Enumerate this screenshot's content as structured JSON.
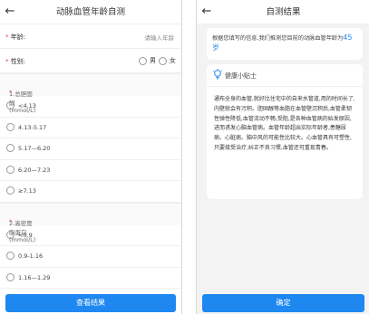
{
  "left": {
    "title": "动脉血管年龄自测",
    "age": {
      "label": "年龄:",
      "placeholder": "请输入年龄"
    },
    "gender": {
      "label": "性别:",
      "options": [
        "男",
        "女"
      ]
    },
    "q1": {
      "title": "1.总胆固醇(mmol/L)",
      "options": [
        "<4.13",
        "4.13-5.17",
        "5.17—6.20",
        "6.20—7.23",
        "≥7.13"
      ]
    },
    "q2": {
      "title": "2.高密度脂蛋白(mmol/L)",
      "options": [
        "<0.9",
        "0.9-1.16",
        "1.16—1.29"
      ]
    },
    "submit_label": "查看结果"
  },
  "right": {
    "title": "自测结果",
    "result_text": "根据您填写的信息,我们推测您目前的动脉血管年龄为",
    "result_age": "45岁",
    "tips_title": "健康小贴士",
    "tips_body": "通布全身的血管,就好比住宅中的自来水管道,用的时间长了,内壁就会有污积。胆固醇等血脂在血管壁沉积后,血管柔韧性弹性降低,血管流动不畅,受阻,是各种血管病的始发原因,进而诱发心脑血管病。血管年龄超出实际年龄者,患糖尿病、心脏病、脑中风的可能性比较大。心血管具有可塑性,只要接受治疗,纠正不良习惯,血管还可重现青春。",
    "confirm_label": "确定"
  },
  "colors": {
    "accent": "#1e88f0",
    "required": "#e64340"
  }
}
